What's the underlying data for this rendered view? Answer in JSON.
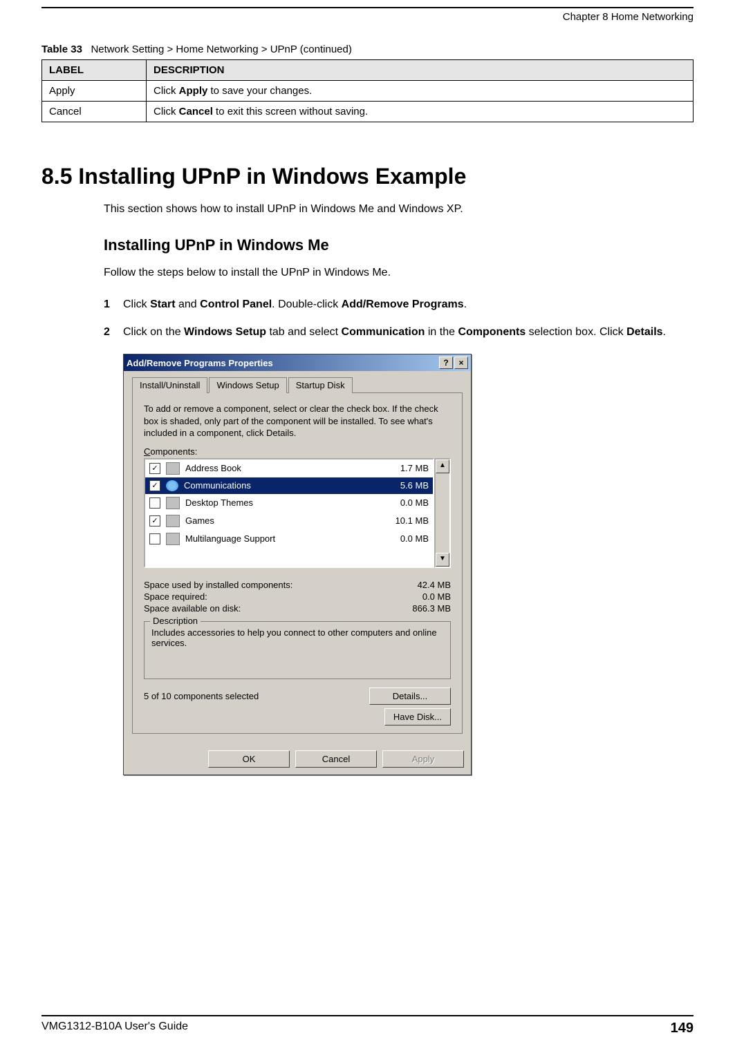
{
  "header": {
    "chapter": "Chapter 8 Home Networking"
  },
  "table": {
    "caption_num": "Table 33",
    "caption_text": "Network Setting > Home Networking > UPnP (continued)",
    "col_label": "LABEL",
    "col_desc": "DESCRIPTION",
    "rows": [
      {
        "label": "Apply",
        "desc_pre": "Click ",
        "desc_bold": "Apply",
        "desc_post": " to save your changes."
      },
      {
        "label": "Cancel",
        "desc_pre": "Click ",
        "desc_bold": "Cancel",
        "desc_post": " to exit this screen without saving."
      }
    ]
  },
  "section": {
    "heading": "8.5  Installing UPnP in Windows Example",
    "intro": "This section shows how to install UPnP in Windows Me and Windows XP.",
    "sub_heading": "Installing UPnP in Windows Me",
    "sub_intro": "Follow the steps below to install the UPnP in Windows Me."
  },
  "steps": [
    {
      "num": "1",
      "parts": [
        "Click ",
        "Start",
        " and ",
        "Control Panel",
        ". Double-click ",
        "Add/Remove Programs",
        "."
      ]
    },
    {
      "num": "2",
      "parts": [
        "Click on the ",
        "Windows Setup",
        " tab and select ",
        "Communication",
        " in the ",
        "Components",
        " selection box. Click ",
        "Details",
        "."
      ]
    }
  ],
  "dialog": {
    "title": "Add/Remove Programs Properties",
    "help_btn": "?",
    "close_btn": "×",
    "tabs": {
      "install": "Install/Uninstall",
      "setup": "Windows Setup",
      "startup": "Startup Disk"
    },
    "help_text": "To add or remove a component, select or clear the check box. If the check box is shaded, only part of the component will be installed. To see what's included in a component, click Details.",
    "components_label": "Components:",
    "items": [
      {
        "checked": true,
        "name": "Address Book",
        "size": "1.7 MB",
        "selected": false
      },
      {
        "checked": true,
        "name": "Communications",
        "size": "5.6 MB",
        "selected": true
      },
      {
        "checked": false,
        "name": "Desktop Themes",
        "size": "0.0 MB",
        "selected": false
      },
      {
        "checked": true,
        "name": "Games",
        "size": "10.1 MB",
        "selected": false
      },
      {
        "checked": false,
        "name": "Multilanguage Support",
        "size": "0.0 MB",
        "selected": false
      }
    ],
    "scroll_up": "▲",
    "scroll_down": "▼",
    "space": {
      "used_label": "Space used by installed components:",
      "used_val": "42.4 MB",
      "req_label": "Space required:",
      "req_val": "0.0 MB",
      "avail_label": "Space available on disk:",
      "avail_val": "866.3 MB"
    },
    "desc_legend": "Description",
    "desc_text": "Includes accessories to help you connect to other computers and online services.",
    "selected_text": "5 of 10 components selected",
    "details_btn": "Details...",
    "havedisk_btn": "Have Disk...",
    "ok_btn": "OK",
    "cancel_btn": "Cancel",
    "apply_btn": "Apply"
  },
  "footer": {
    "guide": "VMG1312-B10A User's Guide",
    "page": "149"
  }
}
